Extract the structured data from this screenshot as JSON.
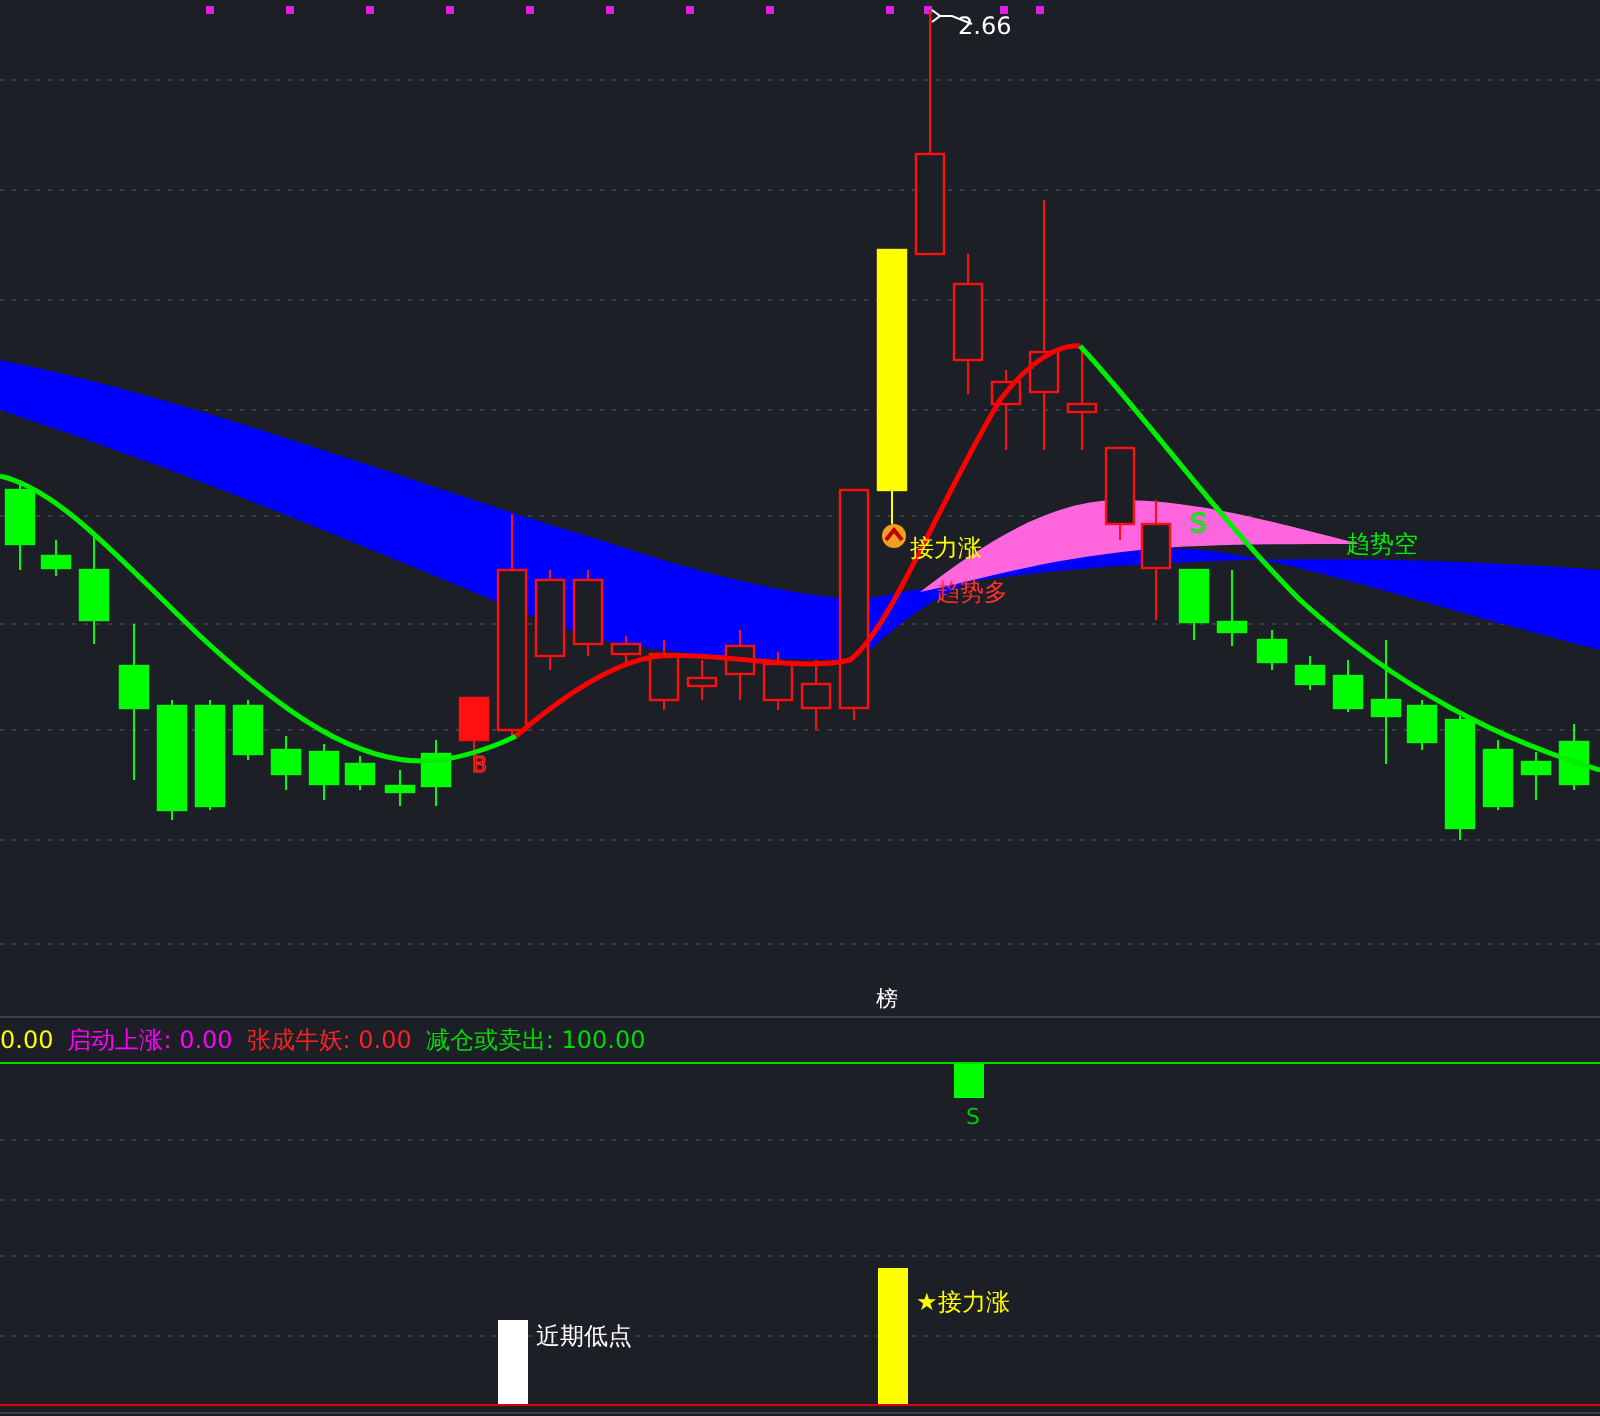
{
  "price_chart": {
    "peak_label": "2.66",
    "buy_mark": "B",
    "sell_mark": "S",
    "relay_label": "接力涨",
    "trend_up_label": "趋势多",
    "trend_down_label": "趋势空"
  },
  "panel_tag": "榜",
  "legend": [
    {
      "text": "0.00",
      "color": "#ffff00"
    },
    {
      "text": "启动上涨: 0.00",
      "color": "#ff00ff"
    },
    {
      "text": "张成牛妖: 0.00",
      "color": "#ff2020"
    },
    {
      "text": "减仓或卖出: 100.00",
      "color": "#00dd00"
    }
  ],
  "signal_panel": {
    "sell_mark": "S",
    "markers": [
      {
        "kind": "low",
        "text": "近期低点"
      },
      {
        "kind": "relay",
        "text": "★接力涨"
      }
    ]
  }
}
